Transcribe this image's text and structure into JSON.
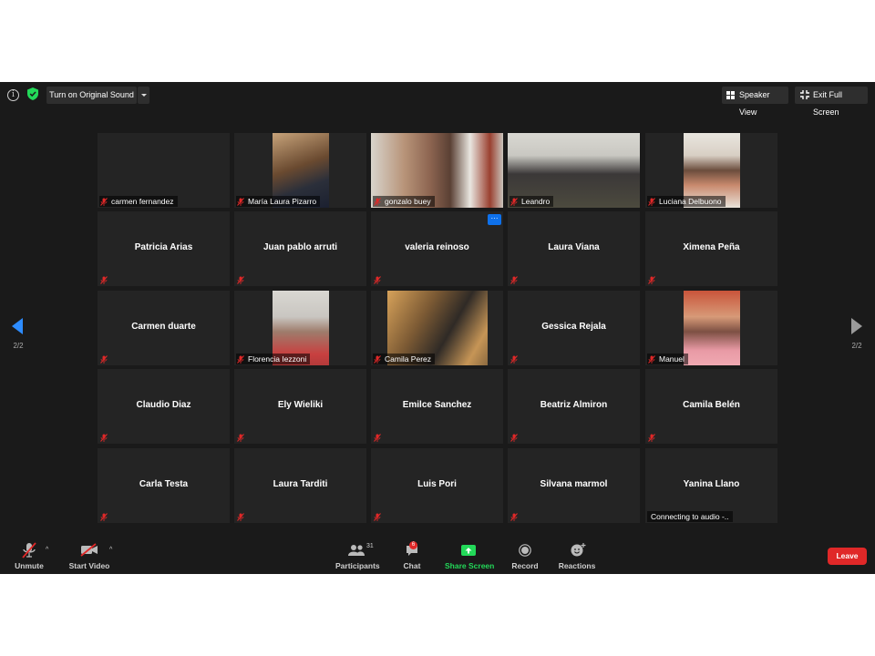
{
  "top_bar": {
    "original_sound": "Turn on Original Sound",
    "speaker_view": "Speaker View",
    "exit_full_screen": "Exit Full Screen"
  },
  "pager": {
    "left": "2/2",
    "right": "2/2"
  },
  "participants": [
    {
      "name": "carmen fernandez",
      "video": false,
      "label_style": "corner",
      "muted": true
    },
    {
      "name": "María Laura Pizarro",
      "video": true,
      "muted": true
    },
    {
      "name": "gonzalo buey",
      "video": true,
      "muted": true
    },
    {
      "name": "Leandro",
      "video": true,
      "muted": true
    },
    {
      "name": "Luciana Delbuono",
      "video": true,
      "muted": true
    },
    {
      "name": "Patricia Arias",
      "video": false,
      "muted": true
    },
    {
      "name": "Juan pablo arruti",
      "video": false,
      "muted": true
    },
    {
      "name": "valeria reinoso",
      "video": false,
      "muted": true
    },
    {
      "name": "Laura Viana",
      "video": false,
      "muted": true
    },
    {
      "name": "Ximena Peña",
      "video": false,
      "muted": true
    },
    {
      "name": "Carmen  duarte",
      "video": false,
      "muted": true
    },
    {
      "name": "Florencia Iezzoni",
      "video": true,
      "muted": true
    },
    {
      "name": "Camila Perez",
      "video": true,
      "muted": true
    },
    {
      "name": "Gessica Rejala",
      "video": false,
      "muted": true
    },
    {
      "name": "Manuel",
      "video": true,
      "muted": true
    },
    {
      "name": "Claudio Diaz",
      "video": false,
      "muted": true
    },
    {
      "name": "Ely Wieliki",
      "video": false,
      "muted": true
    },
    {
      "name": "Emilce Sanchez",
      "video": false,
      "muted": true
    },
    {
      "name": "Beatriz Almiron",
      "video": false,
      "muted": true
    },
    {
      "name": "Camila Belén",
      "video": false,
      "muted": true
    },
    {
      "name": "Carla Testa",
      "video": false,
      "muted": true
    },
    {
      "name": "Laura Tarditi",
      "video": false,
      "muted": true
    },
    {
      "name": "Luis Pori",
      "video": false,
      "muted": true
    },
    {
      "name": "Silvana marmol",
      "video": false,
      "muted": true
    },
    {
      "name": "Yanina Llano",
      "video": false,
      "muted": false,
      "status": "Connecting to audio -.."
    }
  ],
  "toolbar": {
    "unmute": "Unmute",
    "start_video": "Start Video",
    "participants": "Participants",
    "participants_count": "31",
    "chat": "Chat",
    "chat_badge": "6",
    "share_screen": "Share Screen",
    "record": "Record",
    "reactions": "Reactions",
    "leave": "Leave"
  },
  "colors": {
    "background": "#1a1a1a",
    "tile": "#242424",
    "share_green": "#23d959",
    "leave_red": "#e02828",
    "pager_blue": "#2d8cff",
    "muted_red": "#e02828"
  }
}
